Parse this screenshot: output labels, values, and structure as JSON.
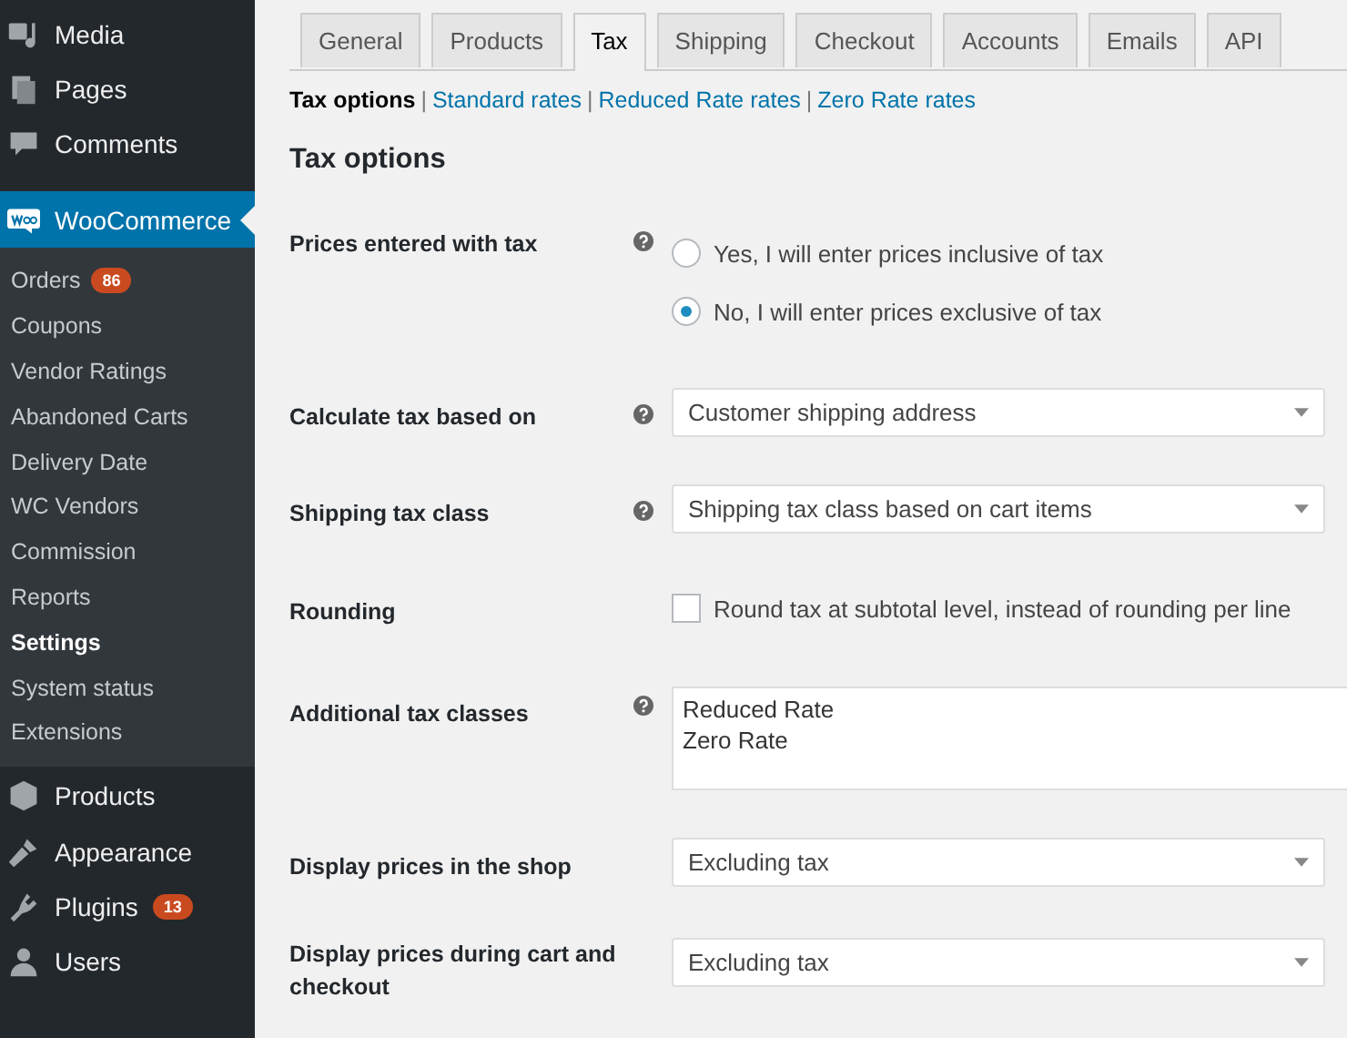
{
  "sidebar": {
    "items": [
      {
        "label": "Media",
        "selected": false
      },
      {
        "label": "Pages",
        "selected": false
      },
      {
        "label": "Comments",
        "selected": false
      },
      {
        "label": "WooCommerce",
        "selected": true,
        "children": [
          {
            "label": "Orders",
            "badge": "86",
            "selected": false
          },
          {
            "label": "Coupons",
            "selected": false
          },
          {
            "label": "Vendor Ratings",
            "selected": false
          },
          {
            "label": "Abandoned Carts",
            "selected": false
          },
          {
            "label": "Delivery Date",
            "selected": false
          },
          {
            "label": "WC Vendors",
            "selected": false
          },
          {
            "label": "Commission",
            "selected": false
          },
          {
            "label": "Reports",
            "selected": false
          },
          {
            "label": "Settings",
            "selected": true
          },
          {
            "label": "System status",
            "selected": false
          },
          {
            "label": "Extensions",
            "selected": false
          }
        ]
      },
      {
        "label": "Products",
        "selected": false
      },
      {
        "label": "Appearance",
        "selected": false
      },
      {
        "label": "Plugins",
        "badge": "13",
        "selected": false
      },
      {
        "label": "Users",
        "selected": false
      }
    ]
  },
  "tabs": [
    {
      "label": "General",
      "selected": false
    },
    {
      "label": "Products",
      "selected": false
    },
    {
      "label": "Tax",
      "selected": true
    },
    {
      "label": "Shipping",
      "selected": false
    },
    {
      "label": "Checkout",
      "selected": false
    },
    {
      "label": "Accounts",
      "selected": false
    },
    {
      "label": "Emails",
      "selected": false
    },
    {
      "label": "API",
      "selected": false
    }
  ],
  "subnav": [
    {
      "label": "Tax options",
      "selected": true
    },
    {
      "separator": "|",
      "label": "Standard rates",
      "selected": false
    },
    {
      "separator": "|",
      "label": "Reduced Rate rates",
      "selected": false
    },
    {
      "separator": "|",
      "label": "Zero Rate rates",
      "selected": false
    }
  ],
  "heading": "Tax options",
  "fields": [
    {
      "kind": "radio",
      "label": "Prices entered with tax",
      "help": true,
      "options": [
        {
          "label": "Yes, I will enter prices inclusive of tax",
          "selected": false
        },
        {
          "label": "No, I will enter prices exclusive of tax",
          "selected": true
        }
      ]
    },
    {
      "kind": "select",
      "label": "Calculate tax based on",
      "help": true,
      "value": "Customer shipping address"
    },
    {
      "kind": "select",
      "label": "Shipping tax class",
      "help": true,
      "value": "Shipping tax class based on cart items"
    },
    {
      "kind": "checkbox",
      "label": "Rounding",
      "help": false,
      "text": "Round tax at subtotal level, instead of rounding per line",
      "checked": false
    },
    {
      "kind": "textarea",
      "label": "Additional tax classes",
      "help": true,
      "lines": [
        "Reduced Rate",
        "Zero Rate"
      ]
    },
    {
      "kind": "select",
      "label": "Display prices in the shop",
      "help": false,
      "value": "Excluding tax"
    },
    {
      "kind": "select",
      "label": "Display prices during cart and checkout",
      "help": false,
      "value": "Excluding tax"
    }
  ]
}
